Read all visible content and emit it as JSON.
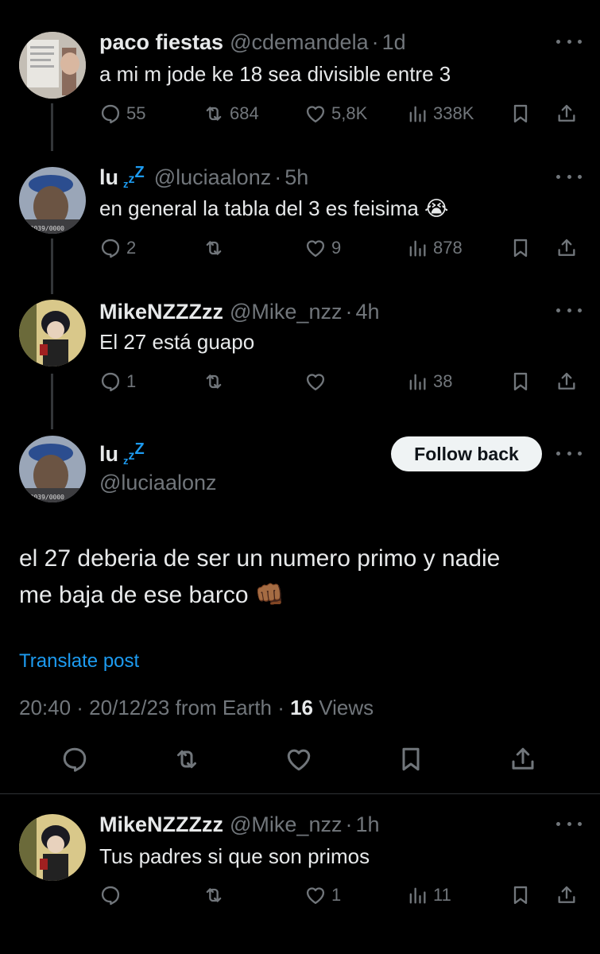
{
  "tweets": [
    {
      "name": "paco fiestas",
      "zzz": false,
      "handle": "@cdemandela",
      "sep": "·",
      "time": "1d",
      "text": "a mi m jode ke 18 sea divisible entre 3",
      "replies": "55",
      "reposts": "684",
      "likes": "5,8K",
      "views": "338K"
    },
    {
      "name": "lu",
      "zzz": true,
      "handle": "@luciaalonz",
      "sep": "·",
      "time": "5h",
      "text": "en general la tabla del 3 es feisima 😭",
      "replies": "2",
      "reposts": "",
      "likes": "9",
      "views": "878"
    },
    {
      "name": "MikeNZZZzz",
      "zzz": false,
      "handle": "@Mike_nzz",
      "sep": "·",
      "time": "4h",
      "text": "El 27 está guapo",
      "replies": "1",
      "reposts": "",
      "likes": "",
      "views": "38"
    }
  ],
  "main_tweet": {
    "name": "lu",
    "handle": "@luciaalonz",
    "follow_label": "Follow back",
    "text_line1": "el 27 deberia de ser un numero primo y nadie",
    "text_line2": "me baja de ese barco 👊🏾",
    "translate": "Translate post",
    "timestamp": "20:40 · 20/12/23 from Earth · ",
    "views_count": "16",
    "views_label": " Views"
  },
  "reply": {
    "name": "MikeNZZZzz",
    "handle": "@Mike_nzz",
    "sep": "·",
    "time": "1h",
    "text": "Tus padres si que son primos",
    "replies": "",
    "reposts": "",
    "likes": "1",
    "views": "11"
  },
  "avatar_watermark": "000039/0000",
  "colors": {
    "background": "#000000",
    "text": "#e7e9ea",
    "muted": "#71767b",
    "accent": "#1d9bf0",
    "follow_bg": "#eff3f4"
  },
  "icons": [
    "reply-icon",
    "repost-icon",
    "like-icon",
    "views-icon",
    "bookmark-icon",
    "share-icon",
    "more-icon"
  ]
}
